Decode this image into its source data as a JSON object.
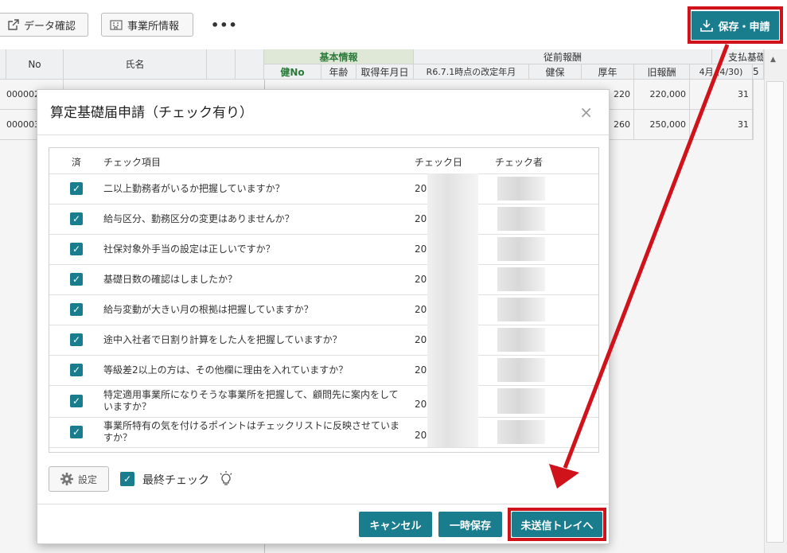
{
  "toolbar": {
    "data_check": "データ確認",
    "office_info": "事業所情報",
    "more": "•••",
    "save_apply": "保存・申請"
  },
  "grid": {
    "headers": {
      "no": "No",
      "name": "氏名",
      "basic_info": "基本情報",
      "prev_salary": "従前報酬",
      "payment": "支払基礎",
      "ken_no": "健No",
      "age": "年齢",
      "acq_date": "取得年月日",
      "revision": "R6.7.1時点の改定年月",
      "kenpo": "健保",
      "kounen": "厚年",
      "old_salary": "旧報酬",
      "april": "4月 (4/30)",
      "next": "5"
    },
    "rows": [
      {
        "no": "000002",
        "kounen": "220",
        "old_salary": "220,000",
        "april": "31"
      },
      {
        "no": "000003",
        "kounen": "260",
        "old_salary": "250,000",
        "april": "31"
      }
    ]
  },
  "modal": {
    "title": "算定基礎届申請（チェック有り）",
    "close": "×",
    "columns": {
      "done": "済",
      "item": "チェック項目",
      "date": "チェック日",
      "checker": "チェック者"
    },
    "items": [
      {
        "text": "二以上勤務者がいるか把握していますか？",
        "date": "20"
      },
      {
        "text": "給与区分、勤務区分の変更はありませんか？",
        "date": "20"
      },
      {
        "text": "社保対象外手当の設定は正しいですか？",
        "date": "20"
      },
      {
        "text": "基礎日数の確認はしましたか？",
        "date": "20"
      },
      {
        "text": "給与変動が大きい月の根拠は把握していますか？",
        "date": "20"
      },
      {
        "text": "途中入社者で日割り計算をした人を把握していますか？",
        "date": "20"
      },
      {
        "text": "等級差2以上の方は、その他欄に理由を入れていますか？",
        "date": "20"
      },
      {
        "text": "特定適用事業所になりそうな事業所を把握して、顧問先に案内をしていますか？",
        "date": "20"
      },
      {
        "text": "事業所特有の気を付けるポイントはチェックリストに反映させていますか？",
        "date": "20"
      }
    ],
    "settings": "設定",
    "final_check": "最終チェック",
    "cancel": "キャンセル",
    "temp_save": "一時保存",
    "to_tray": "未送信トレイへ"
  },
  "colors": {
    "accent": "#1a7d8e",
    "highlight": "#d0121b"
  }
}
